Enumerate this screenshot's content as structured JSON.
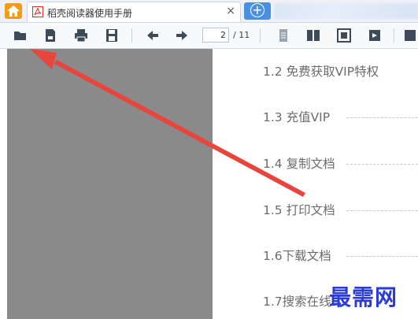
{
  "tab": {
    "title": "稻壳阅读器使用手册",
    "close": "×"
  },
  "toolbar": {
    "page_current": "2",
    "page_total": "/ 11"
  },
  "toc": [
    {
      "label": "1.2 免费获取VIP特权"
    },
    {
      "label": "1.3 充值VIP"
    },
    {
      "label": "1.4 复制文档"
    },
    {
      "label": "1.5 打印文档"
    },
    {
      "label": "1.6下载文档"
    },
    {
      "label": "1.7搜索在线"
    }
  ],
  "watermark": "最需网",
  "colors": {
    "arrow": "#e8453c",
    "accent": "#4a90e2",
    "home": "#f39c12",
    "watermark": "#2b3bd6"
  }
}
